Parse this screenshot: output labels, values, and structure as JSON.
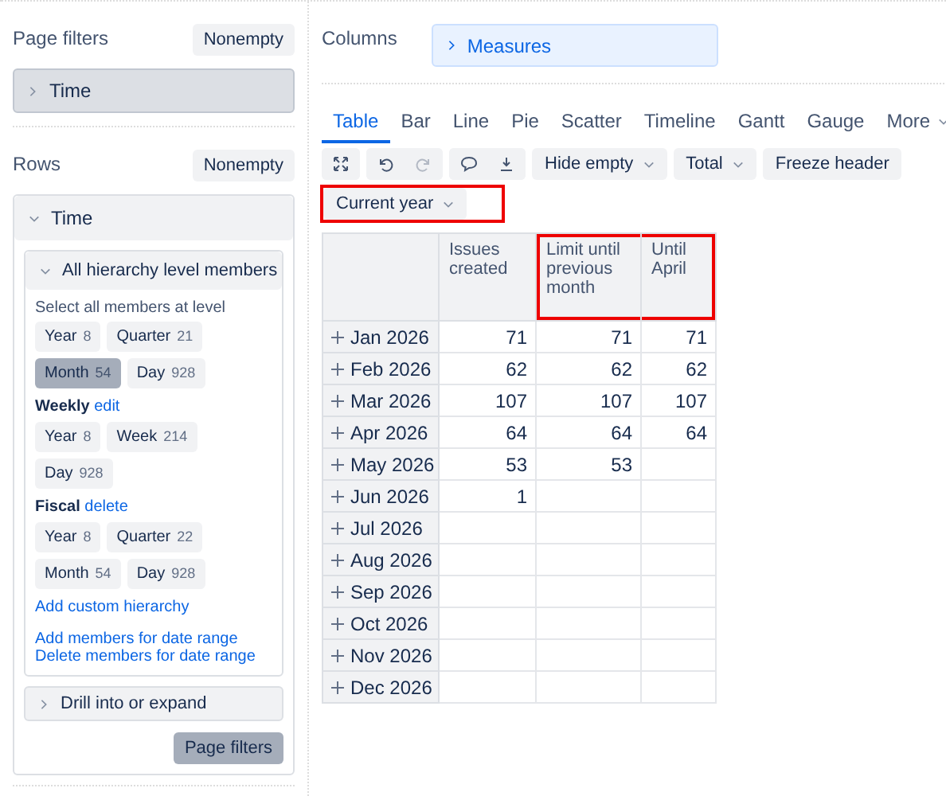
{
  "page_filters": {
    "title": "Page filters",
    "nonempty_button": "Nonempty",
    "items": [
      {
        "label": "Time",
        "expanded": false
      }
    ]
  },
  "rows": {
    "title": "Rows",
    "nonempty_button": "Nonempty",
    "dimension": {
      "label": "Time",
      "expanded": true,
      "section": {
        "title": "All hierarchy level members",
        "expanded": true,
        "hint": "Select all members at level",
        "hierarchies": [
          {
            "chip_rows": [
              [
                {
                  "name": "Year",
                  "count": "8",
                  "selected": false
                },
                {
                  "name": "Quarter",
                  "count": "21",
                  "selected": false
                }
              ],
              [
                {
                  "name": "Month",
                  "count": "54",
                  "selected": true
                },
                {
                  "name": "Day",
                  "count": "928",
                  "selected": false
                }
              ]
            ]
          },
          {
            "name": "Weekly",
            "action": "edit",
            "chip_rows": [
              [
                {
                  "name": "Year",
                  "count": "8",
                  "selected": false
                },
                {
                  "name": "Week",
                  "count": "214",
                  "selected": false
                }
              ],
              [
                {
                  "name": "Day",
                  "count": "928",
                  "selected": false
                }
              ]
            ]
          },
          {
            "name": "Fiscal",
            "action": "delete",
            "chip_rows": [
              [
                {
                  "name": "Year",
                  "count": "8",
                  "selected": false
                },
                {
                  "name": "Quarter",
                  "count": "22",
                  "selected": false
                }
              ],
              [
                {
                  "name": "Month",
                  "count": "54",
                  "selected": false
                },
                {
                  "name": "Day",
                  "count": "928",
                  "selected": false
                }
              ]
            ]
          }
        ],
        "custom_link": "Add custom hierarchy",
        "range_links": [
          "Add members for date range",
          "Delete members for date range"
        ]
      },
      "drill": {
        "label": "Drill into or expand",
        "expanded": false
      },
      "apply_button": "Page filters"
    }
  },
  "columns": {
    "title": "Columns",
    "items": [
      {
        "label": "Measures",
        "expanded": false
      }
    ]
  },
  "tabs": [
    {
      "label": "Table",
      "selected": true,
      "kind": "tab"
    },
    {
      "label": "Bar",
      "selected": false,
      "kind": "tab"
    },
    {
      "label": "Line",
      "selected": false,
      "kind": "tab"
    },
    {
      "label": "Pie",
      "selected": false,
      "kind": "tab"
    },
    {
      "label": "Scatter",
      "selected": false,
      "kind": "tab"
    },
    {
      "label": "Timeline",
      "selected": false,
      "kind": "tab"
    },
    {
      "label": "Gantt",
      "selected": false,
      "kind": "tab"
    },
    {
      "label": "Gauge",
      "selected": false,
      "kind": "tab"
    },
    {
      "label": "More",
      "selected": false,
      "kind": "menu"
    }
  ],
  "toolbar": {
    "icon_groups": [
      [
        {
          "disabled": false
        }
      ],
      [
        {
          "disabled": false
        },
        {
          "disabled": true
        }
      ],
      [
        {
          "disabled": false
        },
        {
          "disabled": false
        }
      ]
    ],
    "dropdowns": [
      "Hide empty",
      "Total"
    ],
    "freeze_button": "Freeze header"
  },
  "date_filter": {
    "label": "Current year",
    "highlighted": true
  },
  "table": {
    "columns": [
      {
        "label": "Issues created",
        "highlighted": false
      },
      {
        "label": "Limit until previous month",
        "highlighted": true
      },
      {
        "label": "Until April",
        "highlighted": true
      }
    ],
    "rows": [
      {
        "label": "Jan 2026",
        "values": [
          "71",
          "71",
          "71"
        ]
      },
      {
        "label": "Feb 2026",
        "values": [
          "62",
          "62",
          "62"
        ]
      },
      {
        "label": "Mar 2026",
        "values": [
          "107",
          "107",
          "107"
        ]
      },
      {
        "label": "Apr 2026",
        "values": [
          "64",
          "64",
          "64"
        ]
      },
      {
        "label": "May 2026",
        "values": [
          "53",
          "53"
        ]
      },
      {
        "label": "Jun 2026",
        "values": [
          "1"
        ]
      },
      {
        "label": "Jul 2026"
      },
      {
        "label": "Aug 2026"
      },
      {
        "label": "Sep 2026"
      },
      {
        "label": "Oct 2026"
      },
      {
        "label": "Nov 2026"
      },
      {
        "label": "Dec 2026"
      }
    ]
  }
}
